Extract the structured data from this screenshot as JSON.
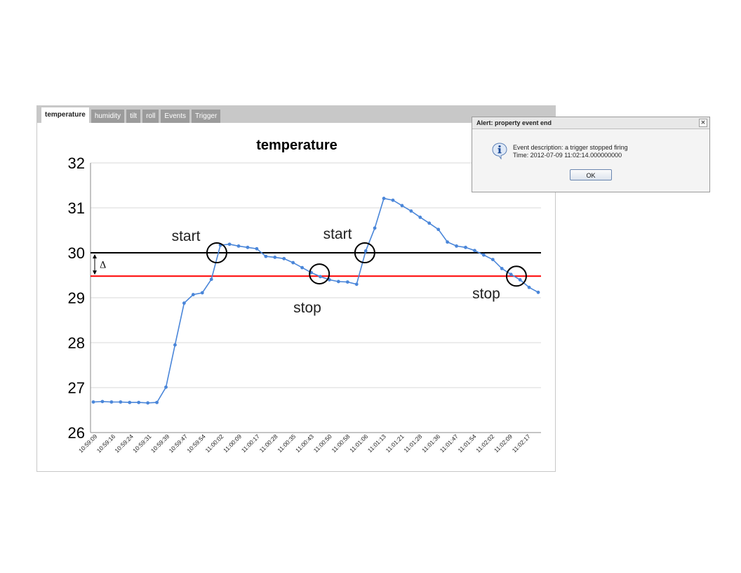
{
  "tabs": [
    {
      "label": "temperature",
      "active": true
    },
    {
      "label": "humidity"
    },
    {
      "label": "tilt"
    },
    {
      "label": "roll"
    },
    {
      "label": "Events"
    },
    {
      "label": "Trigger"
    }
  ],
  "dialog": {
    "title": "Alert: property event end",
    "close_glyph": "✕",
    "line1": "Event description: a trigger stopped firing",
    "line2": "Time: 2012-07-09 11:02:14.000000000",
    "ok_label": "OK",
    "icon": "info-icon"
  },
  "annotations": {
    "start1": "start",
    "start2": "start",
    "stop1": "stop",
    "stop2": "stop",
    "delta": "Δ"
  },
  "colors": {
    "series": "#4a86d9",
    "upper_threshold": "#000000",
    "lower_threshold": "#ff0000"
  },
  "chart_data": {
    "type": "line",
    "title": "temperature",
    "ylim": [
      26,
      32
    ],
    "yticks": [
      26,
      27,
      28,
      29,
      30,
      31,
      32
    ],
    "grid": true,
    "legend": "none",
    "thresholds": {
      "upper": 30.0,
      "lower": 29.48
    },
    "x_tick_labels": [
      "10:59:09",
      "10:59:16",
      "10:59:24",
      "10:59:31",
      "10:59:39",
      "10:59:47",
      "10:59:54",
      "11:00:02",
      "11:00:09",
      "11:00:17",
      "11:00:28",
      "11:00:35",
      "11:00:43",
      "11:00:50",
      "11:00:58",
      "11:01:06",
      "11:01:13",
      "11:01:21",
      "11:01:28",
      "11:01:36",
      "11:01:47",
      "11:01:54",
      "11:02:02",
      "11:02:09",
      "11:02:17"
    ],
    "values": [
      26.68,
      26.69,
      26.68,
      26.68,
      26.67,
      26.67,
      26.66,
      26.67,
      27.01,
      27.95,
      28.88,
      29.07,
      29.11,
      29.41,
      30.17,
      30.19,
      30.15,
      30.12,
      30.09,
      29.92,
      29.9,
      29.87,
      29.78,
      29.67,
      29.56,
      29.47,
      29.4,
      29.36,
      29.35,
      29.3,
      30.04,
      30.55,
      31.21,
      31.17,
      31.05,
      30.93,
      30.79,
      30.66,
      30.52,
      30.24,
      30.15,
      30.12,
      30.05,
      29.95,
      29.85,
      29.65,
      29.52,
      29.4,
      29.23,
      29.12
    ]
  }
}
